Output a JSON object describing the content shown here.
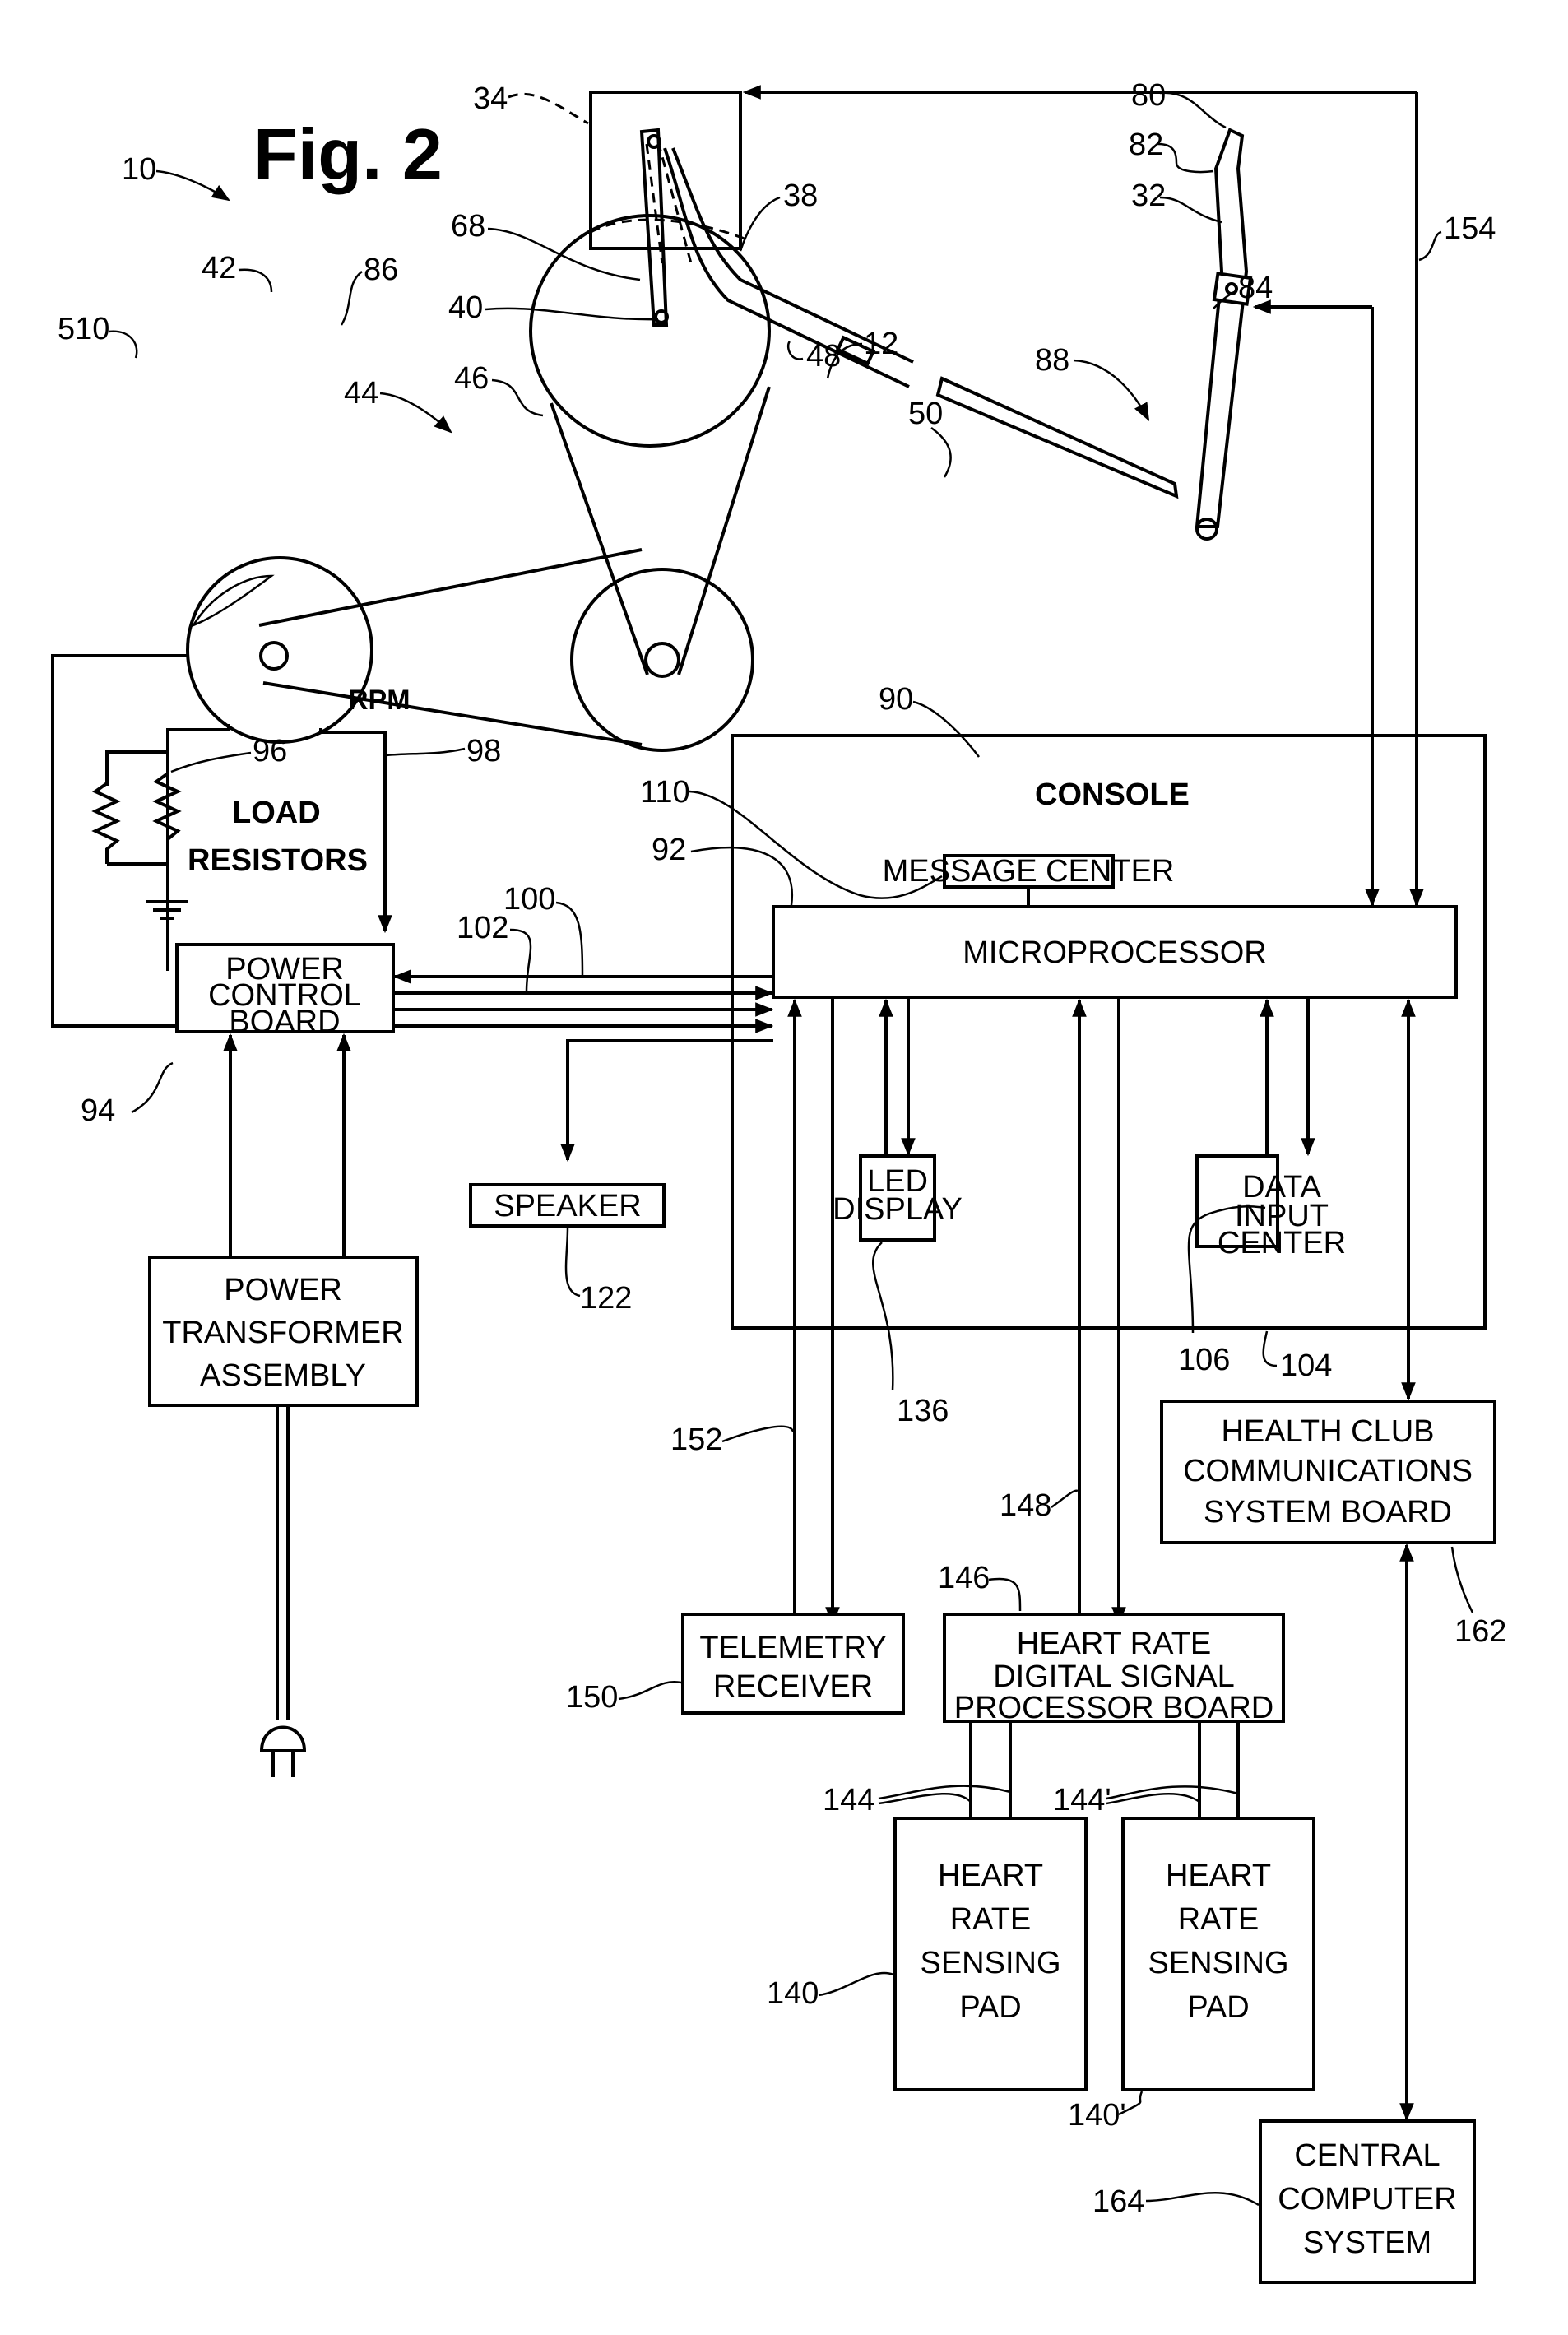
{
  "figure": {
    "title": "Fig. 2",
    "ref_system": "10"
  },
  "mechanical_refs": {
    "r34": "34",
    "r38": "38",
    "r68": "68",
    "r40": "40",
    "r46": "46",
    "r44": "44",
    "r12": "12",
    "r50": "50",
    "r80": "80",
    "r82": "82",
    "r32": "32",
    "r84": "84",
    "r154": "154",
    "r42": "42",
    "r86": "86",
    "r510": "510",
    "r48": "48",
    "r88": "88",
    "r90": "90",
    "r96": "96",
    "r98": "98",
    "r100": "100",
    "r102": "102",
    "r92": "92",
    "r110": "110",
    "r94": "94",
    "r122": "122",
    "r136": "136",
    "r106": "106",
    "r104": "104",
    "r152": "152",
    "r148": "148",
    "r146": "146",
    "r150": "150",
    "r162": "162",
    "r144": "144",
    "r144p": "144'",
    "r140": "140",
    "r140p": "140'",
    "r164": "164"
  },
  "labels": {
    "rpm": "RPM",
    "load_resistors": [
      "LOAD",
      "RESISTORS"
    ],
    "console": "CONSOLE"
  },
  "blocks": {
    "message_center": [
      "MESSAGE CENTER"
    ],
    "microprocessor": [
      "MICROPROCESSOR"
    ],
    "power_control_board": [
      "POWER",
      "CONTROL",
      "BOARD"
    ],
    "speaker": [
      "SPEAKER"
    ],
    "led_display": [
      "LED",
      "DISPLAY"
    ],
    "data_input_center": [
      "DATA",
      "INPUT",
      "CENTER"
    ],
    "power_transformer_assembly": [
      "POWER",
      "TRANSFORMER",
      "ASSEMBLY"
    ],
    "health_club_comm_board": [
      "HEALTH CLUB",
      "COMMUNICATIONS",
      "SYSTEM BOARD"
    ],
    "telemetry_receiver": [
      "TELEMETRY",
      "RECEIVER"
    ],
    "hr_dsp_board": [
      "HEART RATE",
      "DIGITAL SIGNAL",
      "PROCESSOR BOARD"
    ],
    "hr_sensing_pad_1": [
      "HEART",
      "RATE",
      "SENSING",
      "PAD"
    ],
    "hr_sensing_pad_2": [
      "HEART",
      "RATE",
      "SENSING",
      "PAD"
    ],
    "central_computer_system": [
      "CENTRAL",
      "COMPUTER",
      "SYSTEM"
    ]
  }
}
